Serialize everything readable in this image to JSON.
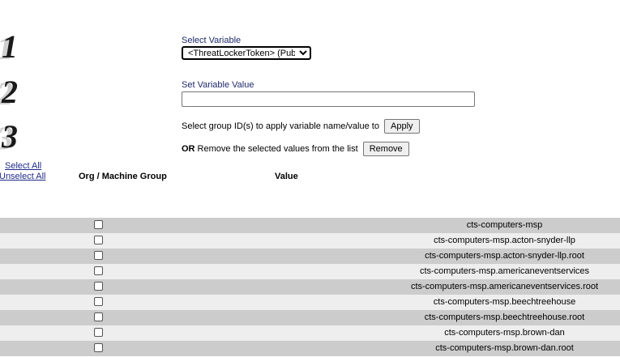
{
  "steps": [
    "1",
    "2",
    "3"
  ],
  "select_variable": {
    "label": "Select Variable",
    "selected": "<ThreatLockerToken> (Pub)"
  },
  "set_value": {
    "label": "Set Variable Value",
    "value": ""
  },
  "apply": {
    "text": "Select group ID(s) to apply variable name/value to",
    "button": "Apply"
  },
  "remove": {
    "or": "OR",
    "text": " Remove the selected values from the list",
    "button": "Remove"
  },
  "selection": {
    "select_all": "Select All",
    "unselect_all": "Unselect All"
  },
  "columns": {
    "group": "Org / Machine Group",
    "value": "Value"
  },
  "rows": [
    "cts-computers-msp",
    "cts-computers-msp.acton-snyder-llp",
    "cts-computers-msp.acton-snyder-llp.root",
    "cts-computers-msp.americaneventservices",
    "cts-computers-msp.americaneventservices.root",
    "cts-computers-msp.beechtreehouse",
    "cts-computers-msp.beechtreehouse.root",
    "cts-computers-msp.brown-dan",
    "cts-computers-msp.brown-dan.root"
  ]
}
